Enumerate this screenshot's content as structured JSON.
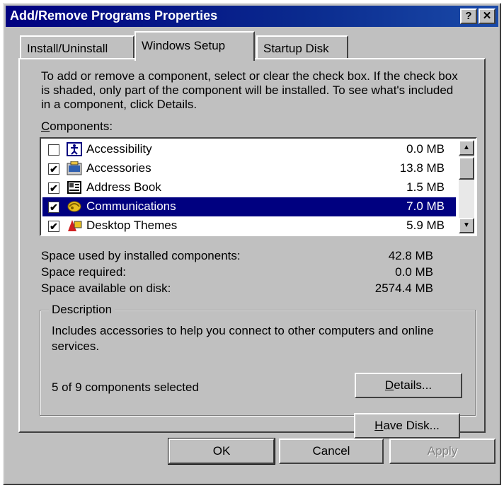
{
  "window": {
    "title": "Add/Remove Programs Properties",
    "help_glyph": "?",
    "close_glyph": "✕"
  },
  "tabs": [
    {
      "label": "Install/Uninstall",
      "active": false
    },
    {
      "label": "Windows Setup",
      "active": true
    },
    {
      "label": "Startup Disk",
      "active": false
    }
  ],
  "setup": {
    "intro_text": "To add or remove a component, select or clear the check box. If the check box is shaded, only part of the component will be installed. To see what's included in a component, click Details.",
    "components_label_accel": "C",
    "components_label_rest": "omponents:",
    "components": [
      {
        "name": "Accessibility",
        "size": "0.0 MB",
        "checked": false,
        "selected": false,
        "icon": "accessibility-icon"
      },
      {
        "name": "Accessories",
        "size": "13.8 MB",
        "checked": true,
        "selected": false,
        "icon": "accessories-icon"
      },
      {
        "name": "Address Book",
        "size": "1.5 MB",
        "checked": true,
        "selected": false,
        "icon": "address-book-icon"
      },
      {
        "name": "Communications",
        "size": "7.0 MB",
        "checked": true,
        "selected": true,
        "icon": "communications-icon"
      },
      {
        "name": "Desktop Themes",
        "size": "5.9 MB",
        "checked": true,
        "selected": false,
        "icon": "desktop-themes-icon"
      }
    ],
    "scroll_up_glyph": "▲",
    "scroll_down_glyph": "▼",
    "check_glyph": "✔",
    "space": [
      {
        "label": "Space used by installed components:",
        "value": "42.8 MB"
      },
      {
        "label": "Space required:",
        "value": "0.0 MB"
      },
      {
        "label": "Space available on disk:",
        "value": "2574.4 MB"
      }
    ],
    "description_title": "Description",
    "description_text": "Includes accessories to help you connect to other computers and online services.",
    "selection_count": "5 of 9 components selected",
    "details_accel": "D",
    "details_rest": "etails...",
    "have_disk_accel": "H",
    "have_disk_rest": "ave Disk..."
  },
  "buttons": {
    "ok": "OK",
    "cancel": "Cancel",
    "apply": "Apply"
  },
  "colors": {
    "title_bar": "#000080",
    "selection": "#000080",
    "face": "#c0c0c0"
  }
}
